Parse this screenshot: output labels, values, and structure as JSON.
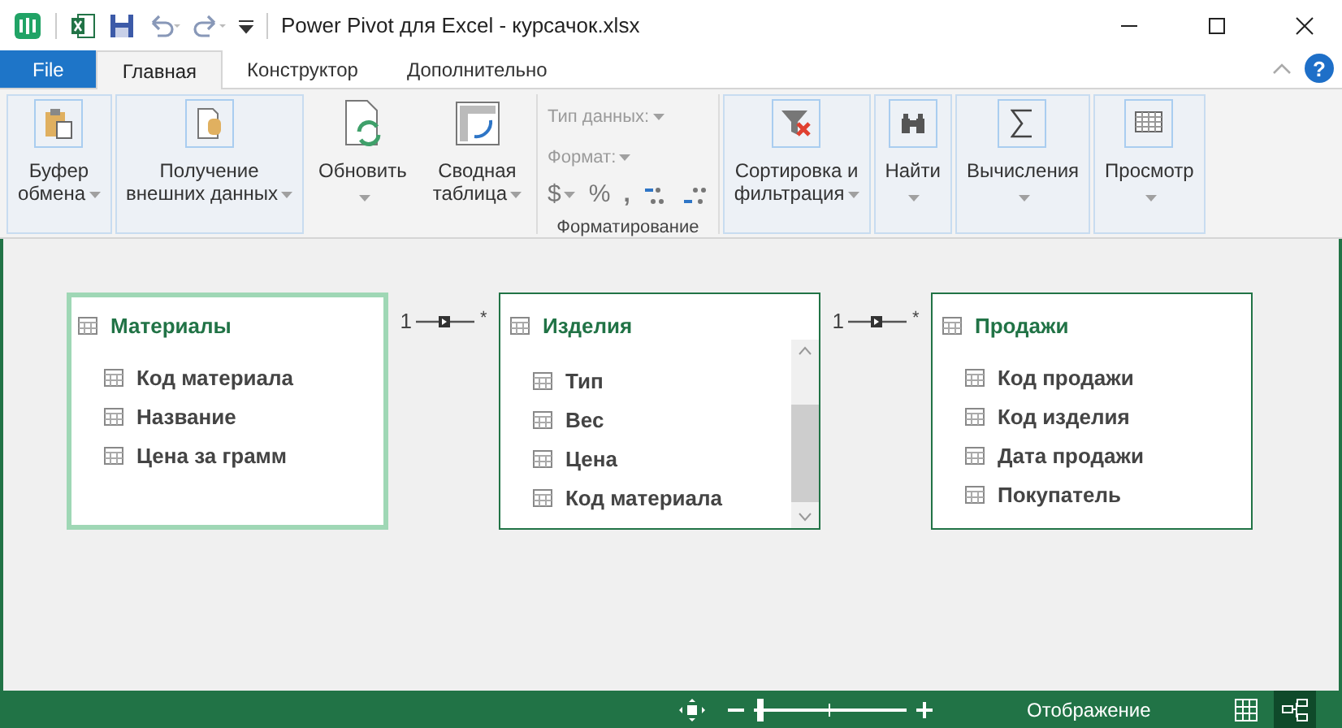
{
  "window": {
    "title": "Power Pivot для Excel - курсачок.xlsx"
  },
  "tabs": [
    {
      "label": "File",
      "kind": "file",
      "selected": false
    },
    {
      "label": "Главная",
      "kind": "tab",
      "selected": true
    },
    {
      "label": "Конструктор",
      "kind": "tab",
      "selected": false
    },
    {
      "label": "Дополнительно",
      "kind": "tab",
      "selected": false
    }
  ],
  "help": "?",
  "ribbon": {
    "groups": [
      {
        "kind": "big",
        "lines": [
          "Буфер",
          "обмена"
        ],
        "framed": true
      },
      {
        "kind": "big",
        "lines": [
          "Получение",
          "внешних данных"
        ],
        "framed": true
      },
      {
        "kind": "big",
        "lines": [
          "Обновить"
        ],
        "framed": false
      },
      {
        "kind": "big",
        "lines": [
          "Сводная",
          "таблица"
        ],
        "framed": false
      },
      {
        "kind": "format",
        "data_type": "Тип данных:",
        "format": "Формат:",
        "currency": "$",
        "percent": "%",
        "comma": ",",
        "label": "Форматирование"
      },
      {
        "kind": "big",
        "lines": [
          "Сортировка и",
          "фильтрация"
        ],
        "framed": true
      },
      {
        "kind": "big",
        "lines": [
          "Найти"
        ],
        "framed": true
      },
      {
        "kind": "big",
        "lines": [
          "Вычисления"
        ],
        "framed": true
      },
      {
        "kind": "big",
        "lines": [
          "Просмотр"
        ],
        "framed": true
      }
    ]
  },
  "diagram": {
    "tables": [
      {
        "name": "Материалы",
        "selected": true,
        "scrollable": false,
        "columns": [
          "Код материала",
          "Название",
          "Цена за грамм"
        ]
      },
      {
        "name": "Изделия",
        "selected": false,
        "scrollable": true,
        "columns": [
          "Тип",
          "Вес",
          "Цена",
          "Код материала"
        ]
      },
      {
        "name": "Продажи",
        "selected": false,
        "scrollable": false,
        "columns": [
          "Код продажи",
          "Код изделия",
          "Дата продажи",
          "Покупатель"
        ]
      }
    ],
    "relations": [
      {
        "one": "1",
        "many": "*"
      },
      {
        "one": "1",
        "many": "*"
      }
    ]
  },
  "status_bar": {
    "zoom": {
      "level": 0.02
    },
    "view_label": "Отображение",
    "views": [
      {
        "kind": "data",
        "selected": false
      },
      {
        "kind": "diagram",
        "selected": true
      }
    ]
  }
}
